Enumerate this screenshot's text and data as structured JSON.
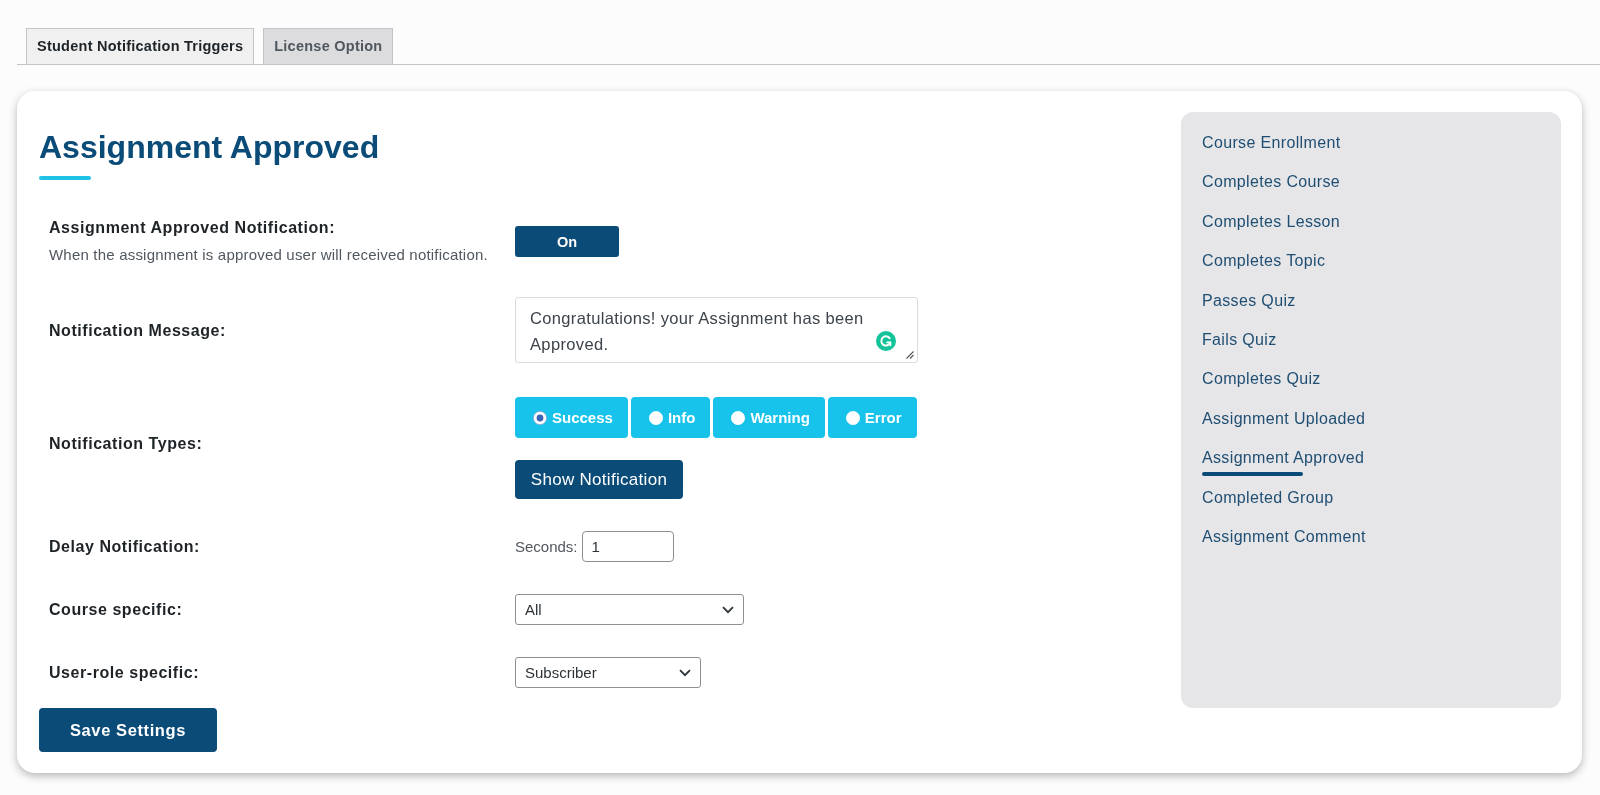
{
  "tabs": [
    {
      "label": "Student Notification Triggers",
      "selected": true
    },
    {
      "label": "License Option",
      "selected": false
    }
  ],
  "heading": "Assignment Approved",
  "settings": {
    "notification_toggle": {
      "label": "Assignment Approved Notification:",
      "description": "When the assignment is approved user will received notification.",
      "button": "On",
      "on": true
    },
    "message": {
      "label": "Notification Message:",
      "value": "Congratulations! your Assignment has been Approved."
    },
    "types": {
      "label": "Notification Types:",
      "options": [
        {
          "label": "Success",
          "selected": true
        },
        {
          "label": "Info",
          "selected": false
        },
        {
          "label": "Warning",
          "selected": false
        },
        {
          "label": "Error",
          "selected": false
        }
      ],
      "button": "Show Notification"
    },
    "delay": {
      "label": "Delay Notification:",
      "field_label": "Seconds:",
      "value": "1"
    },
    "course": {
      "label": "Course specific:",
      "value": "All"
    },
    "user_role": {
      "label": "User-role specific:",
      "value": "Subscriber"
    }
  },
  "save_button": "Save Settings",
  "sidebar": {
    "items": [
      {
        "label": "Course Enrollment",
        "selected": false
      },
      {
        "label": "Completes Course",
        "selected": false
      },
      {
        "label": "Completes Lesson",
        "selected": false
      },
      {
        "label": "Completes Topic",
        "selected": false
      },
      {
        "label": "Passes Quiz",
        "selected": false
      },
      {
        "label": "Fails Quiz",
        "selected": false
      },
      {
        "label": "Completes Quiz",
        "selected": false
      },
      {
        "label": "Assignment Uploaded",
        "selected": false
      },
      {
        "label": "Assignment Approved",
        "selected": true
      },
      {
        "label": "Completed Group",
        "selected": false
      },
      {
        "label": "Assignment Comment",
        "selected": false
      }
    ]
  }
}
